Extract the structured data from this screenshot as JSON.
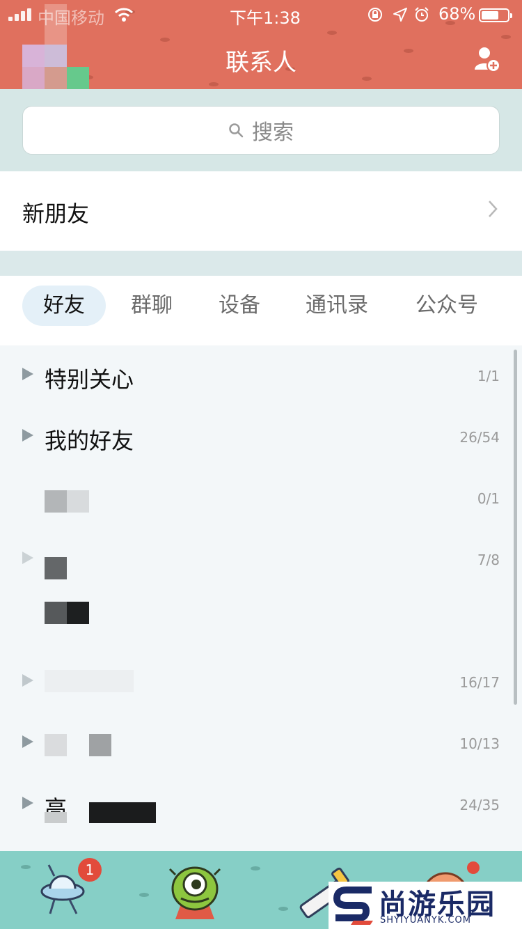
{
  "status_bar": {
    "carrier": "中国移动",
    "time": "下午1:38",
    "battery": "68%",
    "battery_level": 0.68
  },
  "header": {
    "title": "联系人"
  },
  "search": {
    "placeholder": "搜索"
  },
  "new_friend": {
    "label": "新朋友"
  },
  "tabs": [
    {
      "label": "好友",
      "active": true
    },
    {
      "label": "群聊",
      "active": false
    },
    {
      "label": "设备",
      "active": false
    },
    {
      "label": "通讯录",
      "active": false
    },
    {
      "label": "公众号",
      "active": false
    }
  ],
  "groups": [
    {
      "name": "特别关心",
      "count": "1/1"
    },
    {
      "name": "我的好友",
      "count": "26/54"
    },
    {
      "name": "",
      "count": "0/1"
    },
    {
      "name": "",
      "count": "7/8"
    },
    {
      "name": "",
      "count": ""
    },
    {
      "name": "",
      "count": "16/17"
    },
    {
      "name": "",
      "count": "10/13"
    },
    {
      "name": "高",
      "count": "24/35"
    }
  ],
  "tabbar": {
    "messages_badge": "1"
  },
  "watermark": {
    "name": "尚游乐园",
    "url": "SHYIYUANYK.COM"
  },
  "colors": {
    "header": "#e0705e",
    "search_band": "#d6e7e6",
    "tab_active_bg": "#e4f0f8",
    "tabbar": "#86cfc6",
    "badge": "#e24b3b"
  }
}
